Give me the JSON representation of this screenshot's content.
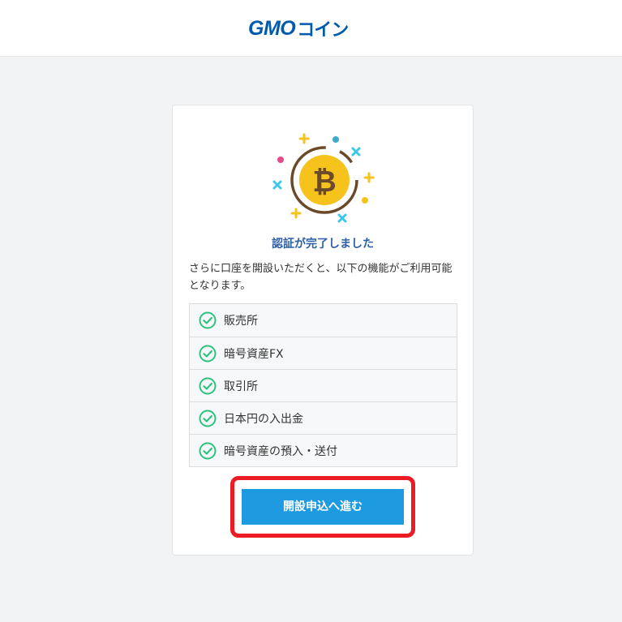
{
  "header": {
    "logo_latin": "GMO",
    "logo_kana": "コイン"
  },
  "card": {
    "title": "認証が完了しました",
    "description": "さらに口座を開設いただくと、以下の機能がご利用可能となります。",
    "features": [
      {
        "label": "販売所"
      },
      {
        "label": "暗号資産FX"
      },
      {
        "label": "取引所"
      },
      {
        "label": "日本円の入出金"
      },
      {
        "label": "暗号資産の預入・送付"
      }
    ],
    "cta_label": "開設申込へ進む"
  },
  "colors": {
    "brand": "#005bac",
    "title": "#2b5da8",
    "cta": "#1e9ae0",
    "check": "#2ec27e",
    "highlight": "#ec1c24",
    "coin": "#f6c21c"
  },
  "icons": {
    "feature_check": "check-circle-icon",
    "illustration": "bitcoin-coin-icon"
  }
}
